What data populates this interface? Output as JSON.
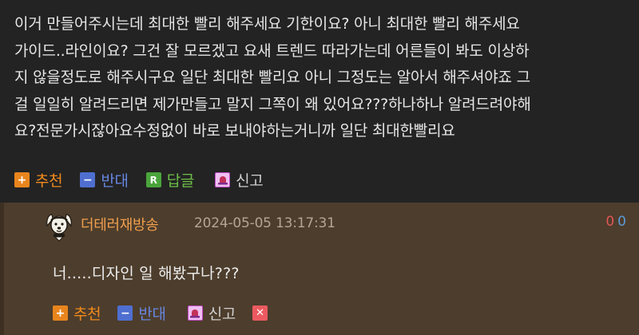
{
  "post": {
    "body_lines": [
      "이거 만들어주시는데 최대한 빨리 해주세요 기한이요? 아니 최대한 빨리 해주세요",
      "가이드..라인이요? 그건 잘 모르겠고 요새 트렌드 따라가는데 어른들이 봐도 이상하",
      "지 않을정도로 해주시구요 일단 최대한 빨리요 아니 그정도는 알아서 해주셔야죠 그",
      "걸 일일히 알려드리면 제가만들고 말지 그쪽이 왜 있어요???하나하나 알려드려야해",
      "요?전문가시잖아요수정없이 바로 보내야하는거니까 일단 최대한빨리요"
    ],
    "actions": {
      "upvote_label": "추천",
      "downvote_label": "반대",
      "reply_label": "답글",
      "report_label": "신고"
    }
  },
  "comment": {
    "author": "더테러재방송",
    "timestamp": "2024-05-05 13:17:31",
    "upvotes": "0",
    "downvotes": "0",
    "body": "너.....디자인 일 해봤구나???",
    "actions": {
      "upvote_label": "추천",
      "downvote_label": "반대",
      "report_label": "신고"
    }
  },
  "icons": {
    "upvote": "plus-icon",
    "downvote": "minus-icon",
    "reply": "reply-r-icon",
    "report": "siren-icon",
    "delete": "close-icon",
    "avatar": "dog-avatar-icon"
  },
  "colors": {
    "post_bg": "#232323",
    "comment_bg": "#4d3d2c",
    "upvote": "#e8851d",
    "downvote": "#4f6fd0",
    "reply": "#4aa43c",
    "author": "#f0a04e"
  }
}
